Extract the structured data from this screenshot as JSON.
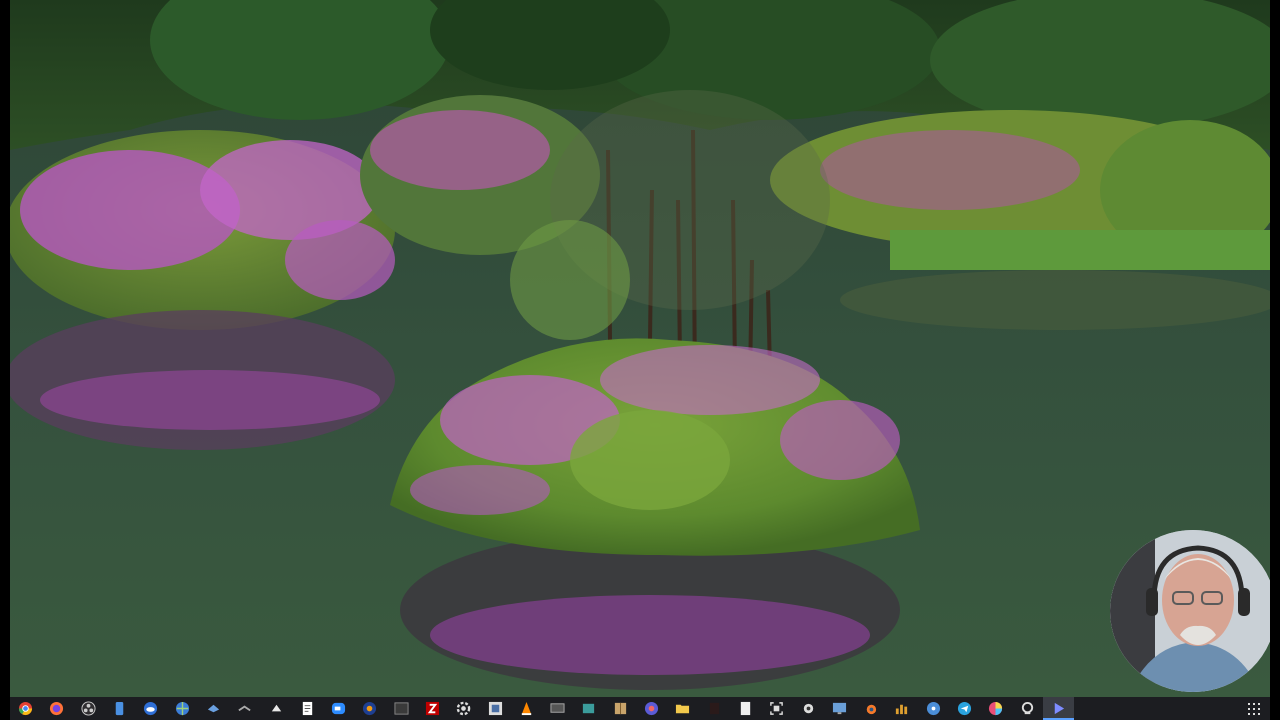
{
  "desktop": {
    "wallpaper_description": "",
    "colors": {
      "water": "#2f4a3a",
      "foliage": "#4f7a2e",
      "blossom": "#c05ac8",
      "taskbar": "#1c1d21"
    }
  },
  "taskbar": {
    "icons": [
      {
        "name": "chrome-icon"
      },
      {
        "name": "firefox-icon"
      },
      {
        "name": "obs-icon"
      },
      {
        "name": "phone-icon"
      },
      {
        "name": "cloud-icon"
      },
      {
        "name": "globe-icon"
      },
      {
        "name": "bird-icon"
      },
      {
        "name": "eagle-icon"
      },
      {
        "name": "shark-icon"
      },
      {
        "name": "document-icon"
      },
      {
        "name": "zoom-icon"
      },
      {
        "name": "media-player-icon"
      },
      {
        "name": "terminal-icon"
      },
      {
        "name": "filezilla-icon"
      },
      {
        "name": "settings-gear-icon"
      },
      {
        "name": "image-viewer-icon"
      },
      {
        "name": "vlc-icon"
      },
      {
        "name": "monitor-icon"
      },
      {
        "name": "package-icon"
      },
      {
        "name": "archive-icon"
      },
      {
        "name": "browser-icon"
      },
      {
        "name": "folder-icon"
      },
      {
        "name": "dark-app-icon"
      },
      {
        "name": "file-icon"
      },
      {
        "name": "screenshot-icon"
      },
      {
        "name": "camera-icon"
      },
      {
        "name": "display-icon"
      },
      {
        "name": "blender-icon"
      },
      {
        "name": "chart-icon"
      },
      {
        "name": "disc-icon"
      },
      {
        "name": "telegram-icon"
      },
      {
        "name": "color-wheel-icon"
      },
      {
        "name": "webcam-app-icon"
      },
      {
        "name": "play-icon",
        "active": true
      }
    ],
    "grid_icon": "app-grid-icon"
  }
}
